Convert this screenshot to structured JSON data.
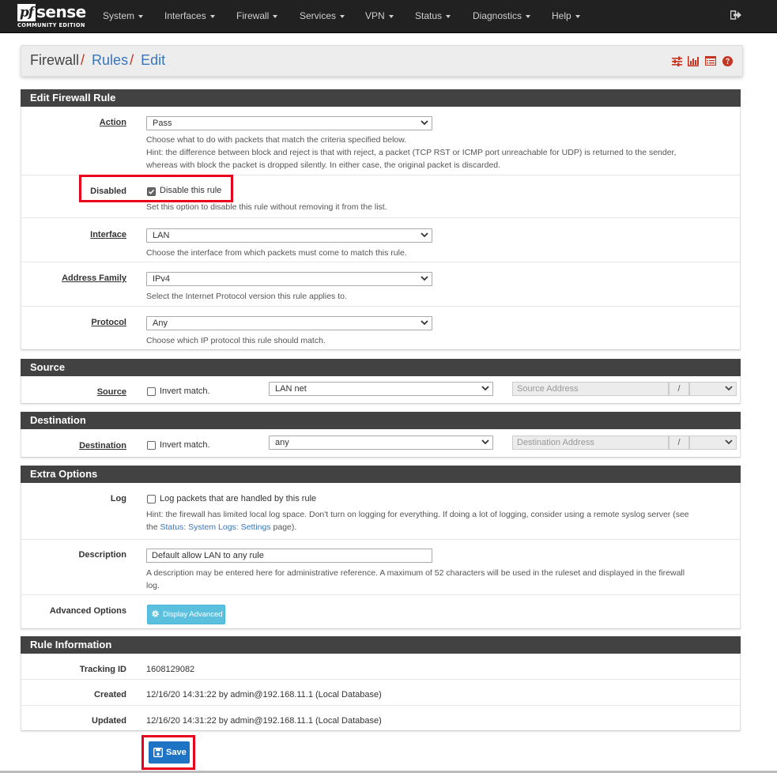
{
  "brand": {
    "logo_pf": "pf",
    "logo_sense": "sense",
    "logo_sub": "COMMUNITY EDITION"
  },
  "nav": {
    "items": [
      {
        "label": "System"
      },
      {
        "label": "Interfaces"
      },
      {
        "label": "Firewall"
      },
      {
        "label": "Services"
      },
      {
        "label": "VPN"
      },
      {
        "label": "Status"
      },
      {
        "label": "Diagnostics"
      },
      {
        "label": "Help"
      }
    ],
    "logout_icon": "sign-out-icon"
  },
  "breadcrumb": {
    "root": "Firewall",
    "sep": "/",
    "rules": "Rules",
    "edit": "Edit"
  },
  "header_icons": [
    "sliders-icon",
    "bar-chart-icon",
    "list-icon",
    "help-circle-icon"
  ],
  "accent_colors": {
    "nav_bg": "#212121",
    "panel_head": "#424242",
    "link": "#3a76b6",
    "save": "#1e73c5",
    "info_btn": "#5bc0de",
    "highlight": "#e8001c"
  },
  "edit_rule": {
    "title": "Edit Firewall Rule",
    "action": {
      "label": "Action",
      "value": "Pass",
      "help1": "Choose what to do with packets that match the criteria specified below.",
      "help2": "Hint: the difference between block and reject is that with reject, a packet (TCP RST or ICMP port unreachable for UDP) is returned to the sender,",
      "help3": "whereas with block the packet is dropped silently. In either case, the original packet is discarded."
    },
    "disabled": {
      "label": "Disabled",
      "checkbox_label": "Disable this rule",
      "checked": true,
      "help": "Set this option to disable this rule without removing it from the list."
    },
    "interface": {
      "label": "Interface",
      "value": "LAN",
      "help": "Choose the interface from which packets must come to match this rule."
    },
    "address_family": {
      "label": "Address Family",
      "value": "IPv4",
      "help": "Select the Internet Protocol version this rule applies to."
    },
    "protocol": {
      "label": "Protocol",
      "value": "Any",
      "help": "Choose which IP protocol this rule should match."
    }
  },
  "source": {
    "title": "Source",
    "label": "Source",
    "invert_label": "Invert match.",
    "type": "LAN net",
    "address_placeholder": "Source Address",
    "slash": "/"
  },
  "destination": {
    "title": "Destination",
    "label": "Destination",
    "invert_label": "Invert match.",
    "type": "any",
    "address_placeholder": "Destination Address",
    "slash": "/"
  },
  "extra": {
    "title": "Extra Options",
    "log": {
      "label": "Log",
      "checkbox_label": "Log packets that are handled by this rule",
      "help1": "Hint: the firewall has limited local log space. Don't turn on logging for everything. If doing a lot of logging, consider using a remote syslog server (see",
      "help2_pre": "the ",
      "help2_link": "Status: System Logs: Settings",
      "help2_post": " page)."
    },
    "description": {
      "label": "Description",
      "value": "Default allow LAN to any rule",
      "help1": "A description may be entered here for administrative reference. A maximum of 52 characters will be used in the ruleset and displayed in the firewall",
      "help2": "log."
    },
    "advanced": {
      "label": "Advanced Options",
      "button": "Display Advanced"
    }
  },
  "rule_info": {
    "title": "Rule Information",
    "tracking": {
      "label": "Tracking ID",
      "value": "1608129082"
    },
    "created": {
      "label": "Created",
      "value": "12/16/20 14:31:22 by admin@192.168.11.1 (Local Database)"
    },
    "updated": {
      "label": "Updated",
      "value": "12/16/20 14:31:22 by admin@192.168.11.1 (Local Database)"
    }
  },
  "save_button": "Save"
}
